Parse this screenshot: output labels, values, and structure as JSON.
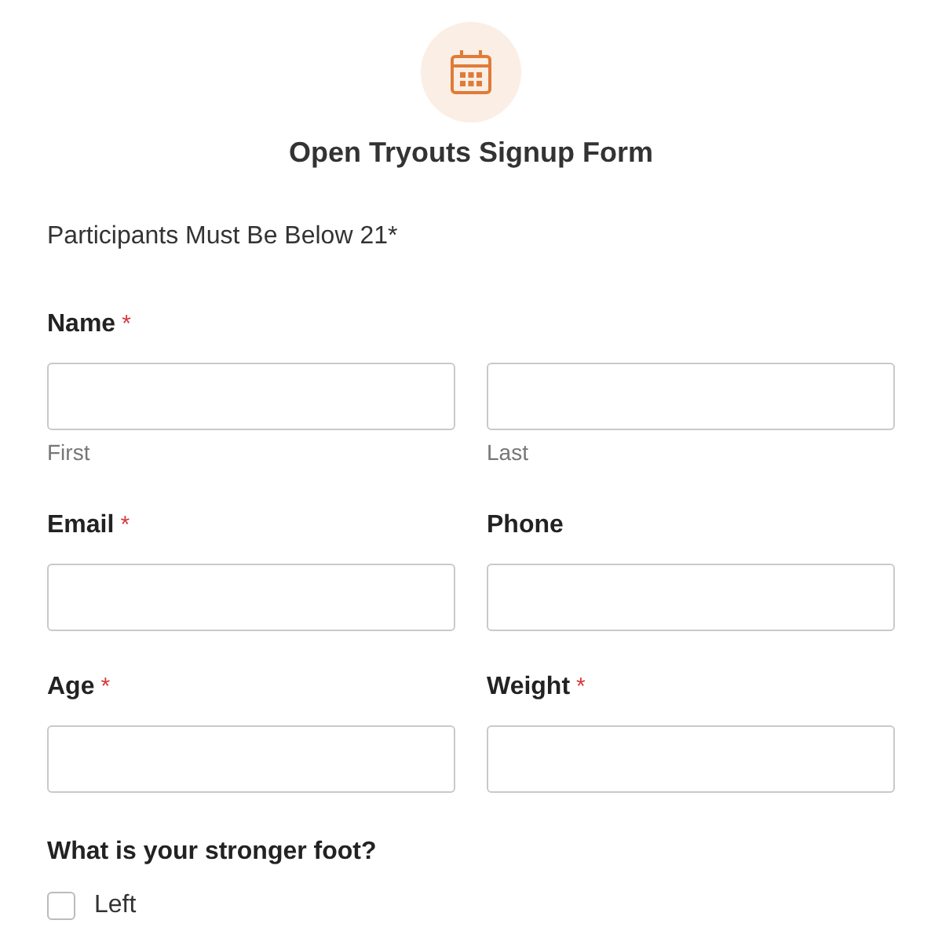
{
  "title": "Open Tryouts Signup Form",
  "description": "Participants Must Be Below 21*",
  "required_mark": "*",
  "rows": [
    {
      "kind": "name",
      "label": "Name",
      "required": true,
      "sublabels": [
        "First",
        "Last"
      ]
    },
    {
      "kind": "pair",
      "items": [
        {
          "label": "Email",
          "required": true
        },
        {
          "label": "Phone",
          "required": false
        }
      ]
    },
    {
      "kind": "pair",
      "items": [
        {
          "label": "Age",
          "required": true
        },
        {
          "label": "Weight",
          "required": true
        }
      ]
    }
  ],
  "question": {
    "label": "What is your stronger foot?",
    "options": [
      {
        "label": "Left",
        "checked": false
      }
    ]
  }
}
